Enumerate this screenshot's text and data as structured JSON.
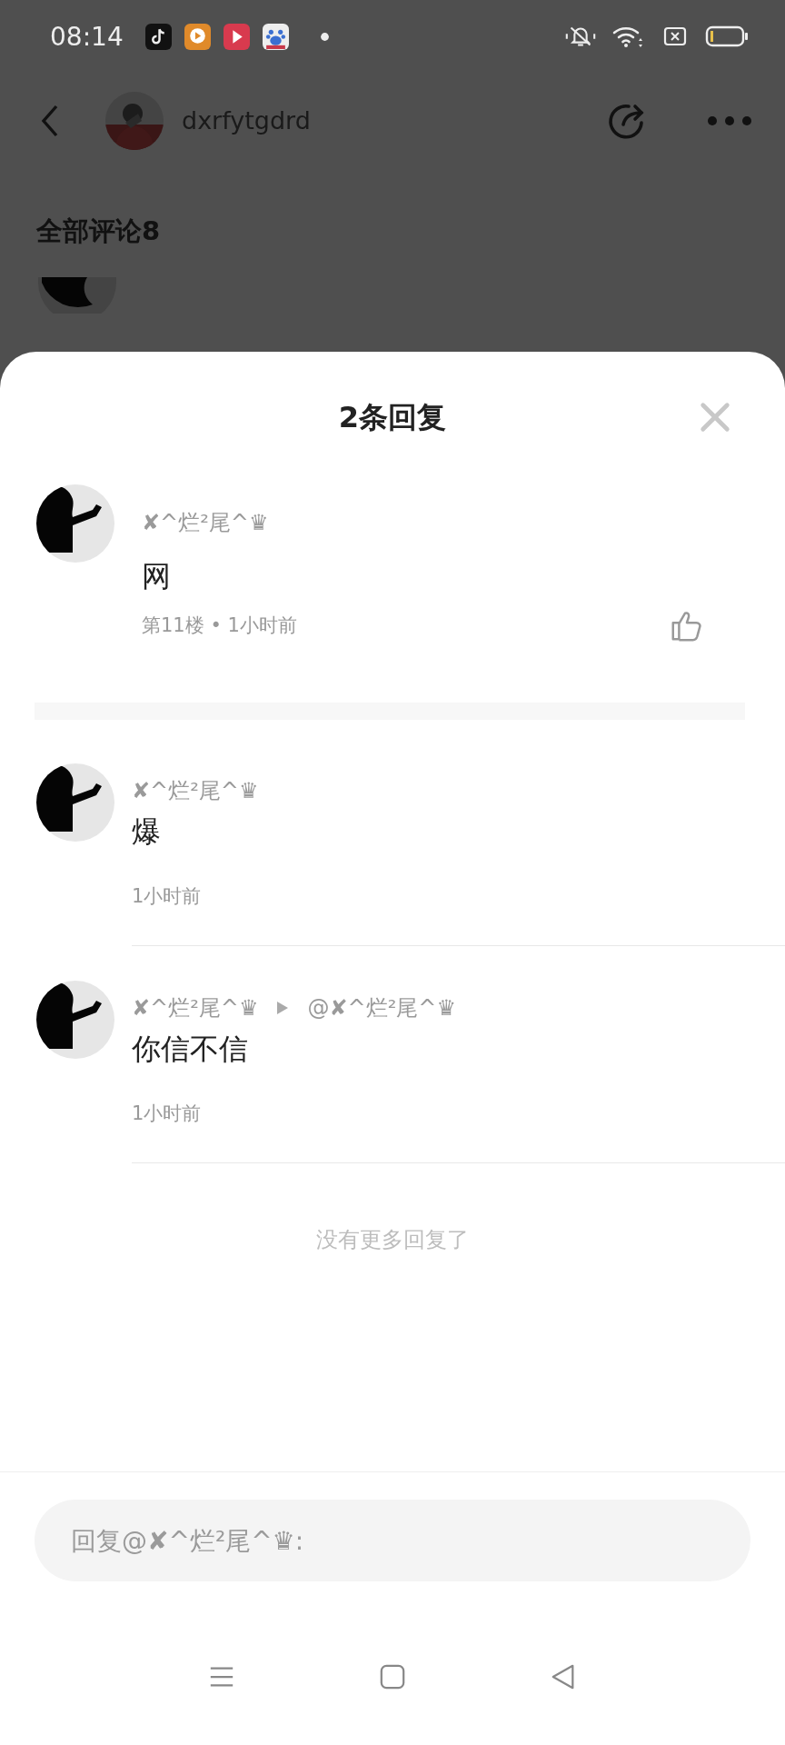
{
  "status_bar": {
    "time": "08:14"
  },
  "header": {
    "username": "dxrfytgdrd"
  },
  "comments_heading": "全部评论8",
  "sheet": {
    "title": "2条回复",
    "main_comment": {
      "author": "✘^烂²尾^♛",
      "content": "网",
      "meta": "第11楼 • 1小时前"
    },
    "replies": [
      {
        "author": "✘^烂²尾^♛",
        "content": "爆",
        "time": "1小时前"
      },
      {
        "author": "✘^烂²尾^♛",
        "reply_to": "@✘^烂²尾^♛",
        "content": "你信不信",
        "time": "1小时前"
      }
    ],
    "end_text": "没有更多回复了",
    "reply_input": {
      "placeholder": "回复@✘^烂²尾^♛:"
    }
  }
}
